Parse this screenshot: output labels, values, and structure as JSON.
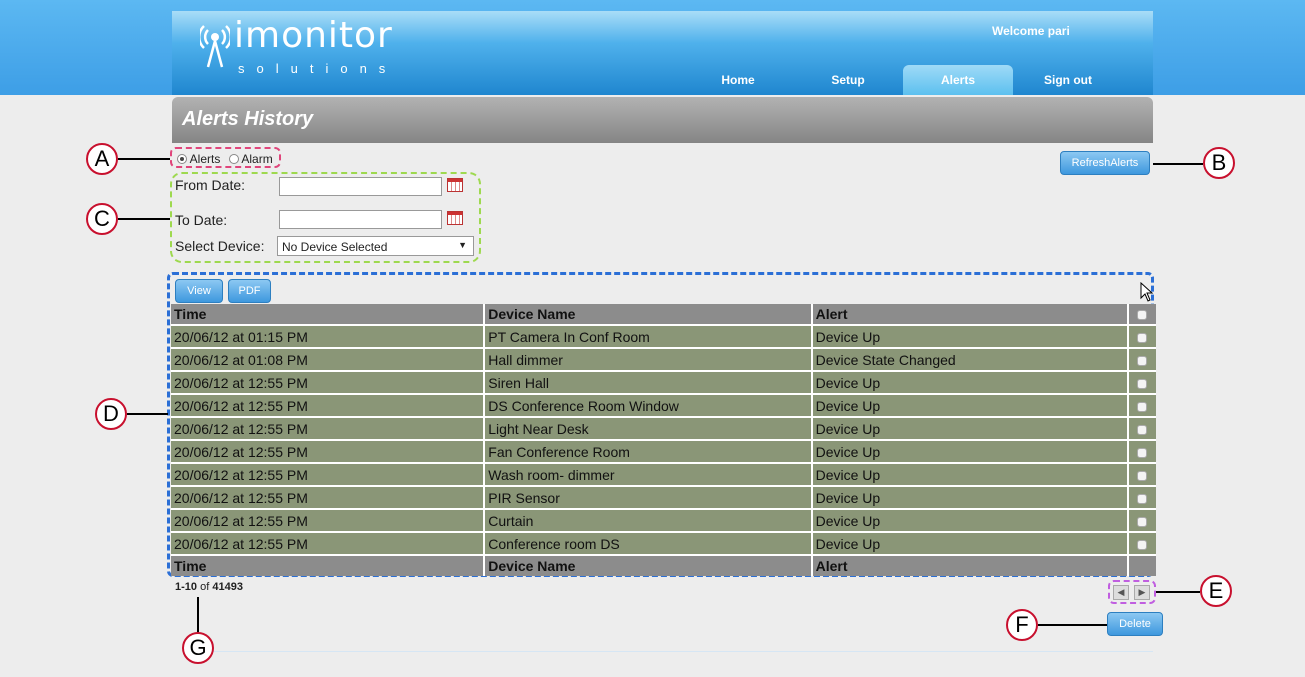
{
  "header": {
    "logo_main": "imonitor",
    "logo_sub": "solutions",
    "welcome": "Welcome pari",
    "nav": [
      {
        "label": "Home",
        "active": false
      },
      {
        "label": "Setup",
        "active": false
      },
      {
        "label": "Alerts",
        "active": true
      },
      {
        "label": "Sign out",
        "active": false
      }
    ]
  },
  "page_title": "Alerts History",
  "filters": {
    "radio_alerts": "Alerts",
    "radio_alarm": "Alarm",
    "selected": "Alerts",
    "from_date_label": "From Date:",
    "from_date_value": "",
    "to_date_label": "To Date:",
    "to_date_value": "",
    "device_label": "Select Device:",
    "device_value": "No Device Selected"
  },
  "buttons": {
    "refresh": "RefreshAlerts",
    "view": "View",
    "pdf": "PDF",
    "delete": "Delete"
  },
  "table": {
    "headers": [
      "Time",
      "Device Name",
      "Alert"
    ],
    "rows": [
      [
        "20/06/12 at 01:15 PM",
        "PT Camera In Conf Room",
        "Device Up"
      ],
      [
        "20/06/12 at 01:08 PM",
        "Hall dimmer",
        "Device State Changed"
      ],
      [
        "20/06/12 at 12:55 PM",
        "Siren Hall",
        "Device Up"
      ],
      [
        "20/06/12 at 12:55 PM",
        "DS Conference Room Window",
        "Device Up"
      ],
      [
        "20/06/12 at 12:55 PM",
        "Light Near Desk",
        "Device Up"
      ],
      [
        "20/06/12 at 12:55 PM",
        "Fan Conference Room",
        "Device Up"
      ],
      [
        "20/06/12 at 12:55 PM",
        "Wash room- dimmer",
        "Device Up"
      ],
      [
        "20/06/12 at 12:55 PM",
        "PIR Sensor",
        "Device Up"
      ],
      [
        "20/06/12 at 12:55 PM",
        "Curtain",
        "Device Up"
      ],
      [
        "20/06/12 at 12:55 PM",
        "Conference room DS",
        "Device Up"
      ]
    ]
  },
  "pager": {
    "range": "1-10",
    "of": "of",
    "total": "41493",
    "prev_icon": "triangle-left-icon",
    "next_icon": "triangle-right-icon"
  },
  "callouts": [
    "A",
    "B",
    "C",
    "D",
    "E",
    "F",
    "G"
  ],
  "colors": {
    "header_blue": "#3d9ee6",
    "row_green": "#8a9677",
    "header_gray": "#8c8c8c",
    "callout_red": "#c8102e",
    "dash_pink": "#e0457b",
    "dash_green": "#9ed94f",
    "dash_blue": "#2b6fd6",
    "dash_purple": "#c05ee0"
  }
}
